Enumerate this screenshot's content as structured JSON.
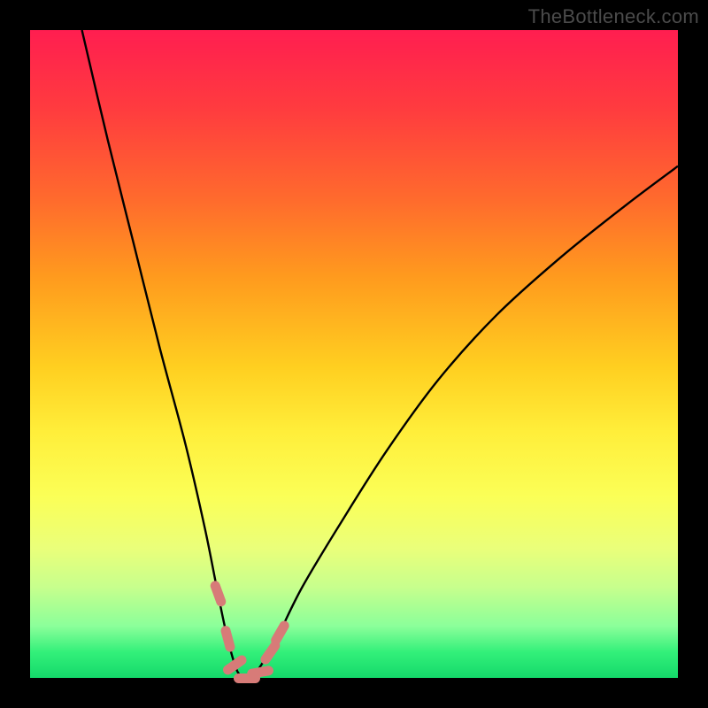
{
  "watermark": "TheBottleneck.com",
  "chart_data": {
    "type": "line",
    "title": "",
    "xlabel": "",
    "ylabel": "",
    "xlim": [
      0,
      100
    ],
    "ylim": [
      0,
      100
    ],
    "series": [
      {
        "name": "bottleneck-curve",
        "x": [
          8,
          12,
          16,
          20,
          24,
          27,
          29,
          30.5,
          32,
          33.5,
          35,
          38,
          42,
          48,
          55,
          63,
          72,
          82,
          92,
          100
        ],
        "values": [
          100,
          83,
          67,
          51,
          36,
          23,
          13,
          6,
          1,
          0,
          1,
          6,
          14,
          24,
          35,
          46,
          56,
          65,
          73,
          79
        ]
      }
    ],
    "optimum_x": 33.5,
    "markers": [
      {
        "x": 29.0,
        "y": 13,
        "angle": -20
      },
      {
        "x": 30.5,
        "y": 6,
        "angle": -15
      },
      {
        "x": 31.5,
        "y": 2,
        "angle": 55
      },
      {
        "x": 33.5,
        "y": 0,
        "angle": 90
      },
      {
        "x": 35.5,
        "y": 1,
        "angle": 80
      },
      {
        "x": 37.0,
        "y": 4,
        "angle": 35
      },
      {
        "x": 38.5,
        "y": 7,
        "angle": 30
      }
    ],
    "colors": {
      "curve": "#000000",
      "marker": "#d77b78"
    }
  }
}
